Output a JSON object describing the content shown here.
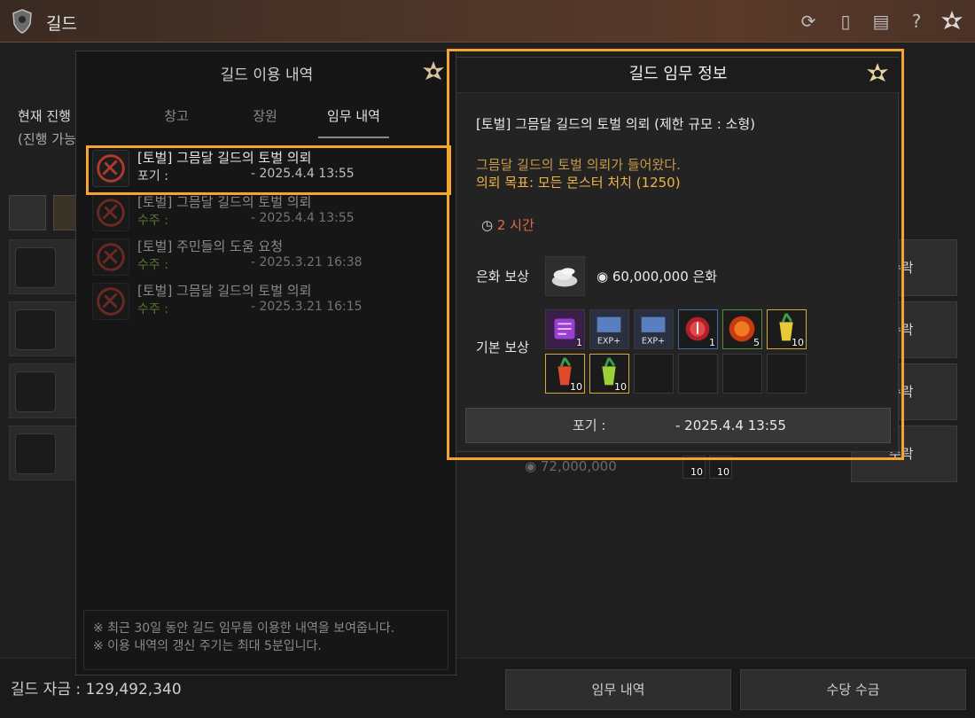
{
  "topbar": {
    "title": "길드"
  },
  "background": {
    "subtitle1": "현재 진행",
    "subtitle2": "(진행 가능",
    "accept_labels": [
      "수락",
      "수락",
      "수락",
      "수락"
    ],
    "peek_silver": "72,000,000",
    "peek_counts": [
      "10",
      "10"
    ]
  },
  "history": {
    "title": "길드 이용 내역",
    "tabs": [
      "창고",
      "장원",
      "임무 내역"
    ],
    "active_tab": "임무 내역",
    "items": [
      {
        "name": "[토벌] 그믐달 길드의 토벌 의뢰",
        "status": "포기 :",
        "date": "- 2025.4.4 13:55",
        "status_color": "#cfcfcf"
      },
      {
        "name": "[토벌] 그믐달 길드의 토벌 의뢰",
        "status": "수주 :",
        "date": "- 2025.4.4 13:55",
        "status_color": "#8fbf4a"
      },
      {
        "name": "[토벌] 주민들의 도움 요청",
        "status": "수주 :",
        "date": "- 2025.3.21 16:38",
        "status_color": "#8fbf4a"
      },
      {
        "name": "[토벌] 그믐달 길드의 토벌 의뢰",
        "status": "수주 :",
        "date": "- 2025.3.21 16:15",
        "status_color": "#8fbf4a"
      }
    ],
    "note_lines": [
      "※ 최근 30일 동안 길드 임무를 이용한 내역을 보여줍니다.",
      "※ 이용 내역의 갱신 주기는 최대 5분입니다."
    ]
  },
  "info": {
    "title": "길드 임무 정보",
    "mission_name": "[토벌] 그믐달 길드의 토벌 의뢰 (제한 규모 : 소형)",
    "description": "그믐달 길드의 토벌 의뢰가 들어왔다.",
    "goal": "의뢰 목표: 모든 몬스터 처치 (1250)",
    "time": "2 시간",
    "silver_label": "은화 보상",
    "silver_value": "60,000,000 은화",
    "basic_label": "기본 보상",
    "reward_items": [
      {
        "icon": "scroll-icon",
        "count": "1"
      },
      {
        "icon": "exp-scroll-icon",
        "label": "EXP+",
        "count": ""
      },
      {
        "icon": "exp-scroll-icon",
        "label": "EXP+",
        "count": ""
      },
      {
        "icon": "red-orb-icon",
        "count": "1"
      },
      {
        "icon": "fire-orb-icon",
        "count": "5"
      },
      {
        "icon": "yellow-drink-icon",
        "count": "10"
      },
      {
        "icon": "red-drink-icon",
        "count": "10"
      },
      {
        "icon": "green-drink-icon",
        "count": "10"
      }
    ],
    "giveup_label": "포기 :",
    "giveup_date": "- 2025.4.4 13:55"
  },
  "footer": {
    "funds": "길드 자금 : 129,492,340",
    "history_button": "임무 내역",
    "allowance_button": "수당 수금"
  },
  "colors": {
    "highlight": "#f2a630",
    "accent_gold": "#f2b441",
    "time_red": "#e06a4a"
  }
}
